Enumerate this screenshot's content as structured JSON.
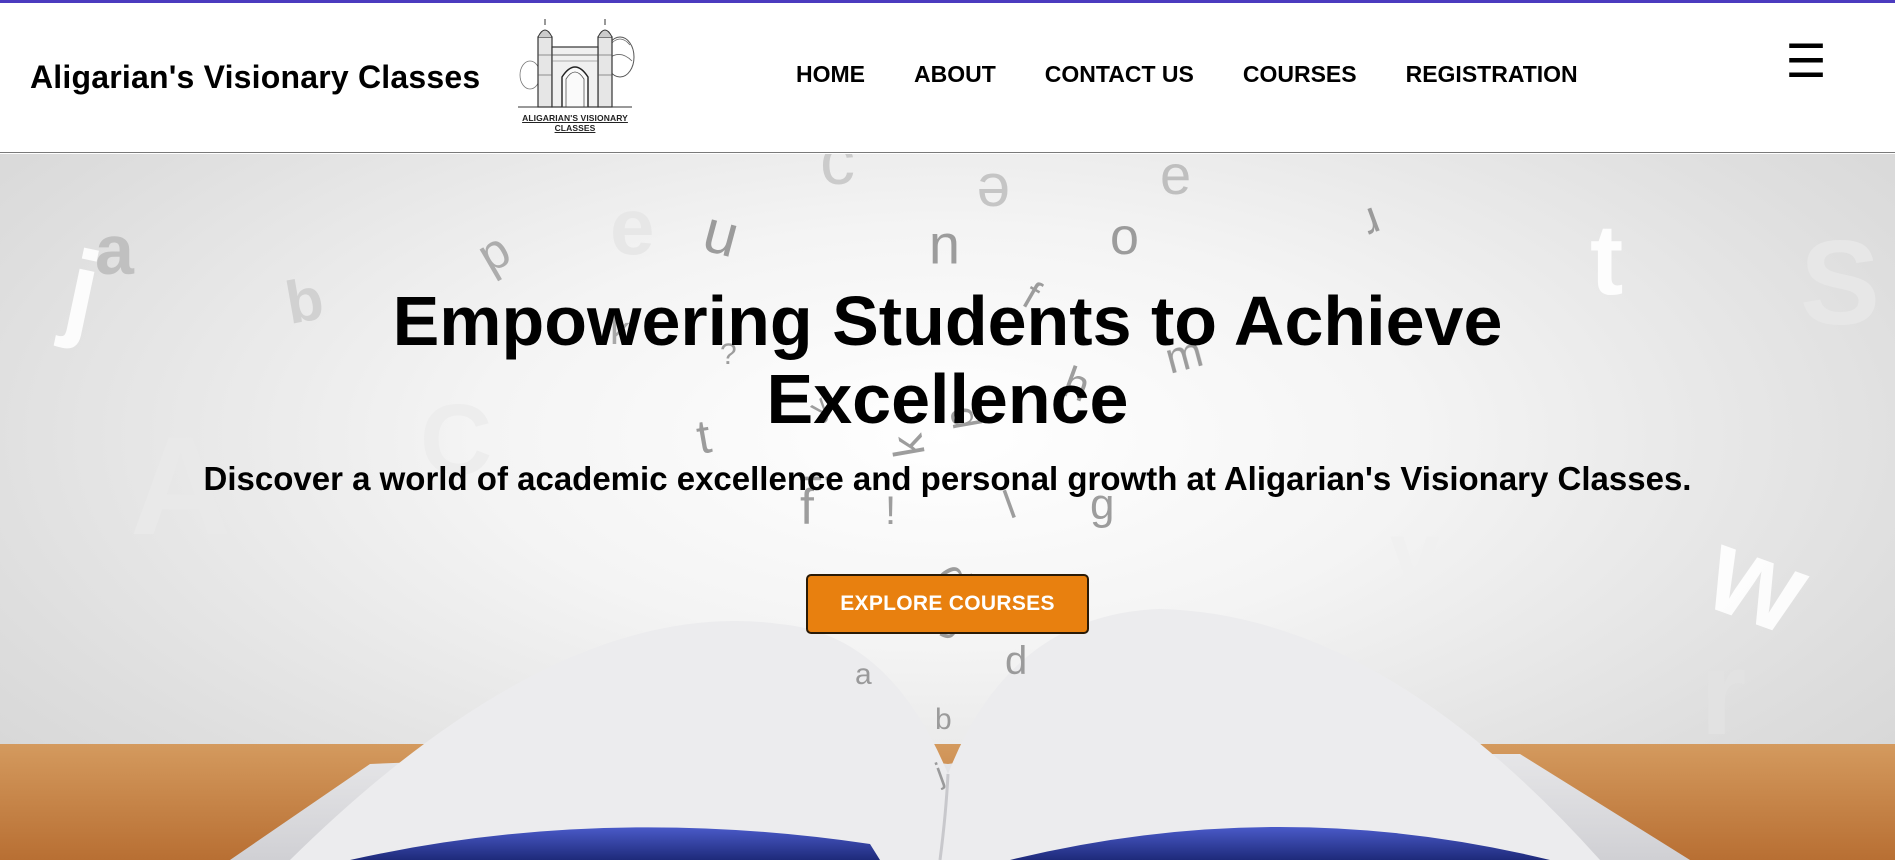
{
  "brand": {
    "name": "Aligarian's Visionary Classes",
    "logo_caption": "ALIGARIAN'S VISIONARY CLASSES"
  },
  "nav": {
    "items": [
      {
        "label": "HOME"
      },
      {
        "label": "ABOUT"
      },
      {
        "label": "CONTACT US"
      },
      {
        "label": "COURSES"
      },
      {
        "label": "REGISTRATION"
      }
    ],
    "menu_icon": "hamburger-icon",
    "menu_glyph": "☰"
  },
  "hero": {
    "title": "Empowering Students to Achieve Excellence",
    "subtitle": "Discover a world of academic excellence and personal growth at Aligarian's Visionary Classes.",
    "cta_label": "EXPLORE COURSES"
  },
  "colors": {
    "accent_line": "#4b3bbf",
    "cta_background": "#e8800f",
    "cta_text": "#ffffff",
    "text": "#000000"
  }
}
